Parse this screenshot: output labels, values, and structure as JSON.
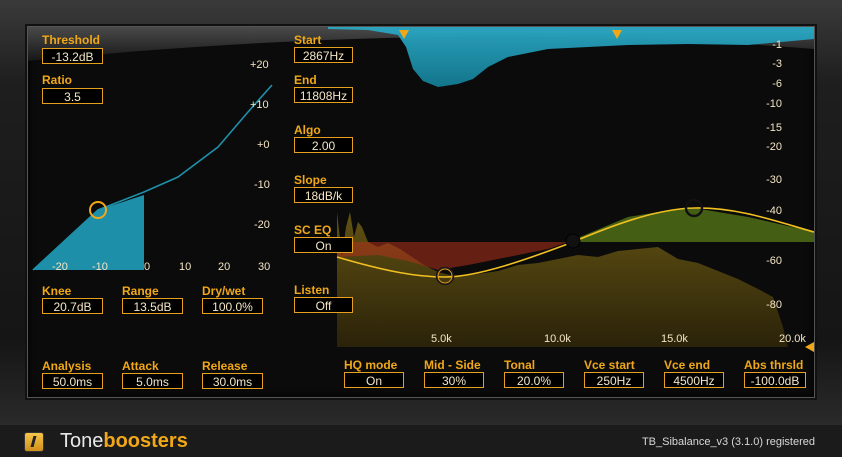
{
  "left_controls": {
    "threshold": {
      "label": "Threshold",
      "value": "-13.2dB"
    },
    "ratio": {
      "label": "Ratio",
      "value": "3.5"
    },
    "knee": {
      "label": "Knee",
      "value": "20.7dB"
    },
    "range": {
      "label": "Range",
      "value": "13.5dB"
    },
    "drywet": {
      "label": "Dry/wet",
      "value": "100.0%"
    },
    "analysis": {
      "label": "Analysis",
      "value": "50.0ms"
    },
    "attack": {
      "label": "Attack",
      "value": "5.0ms"
    },
    "release": {
      "label": "Release",
      "value": "30.0ms"
    }
  },
  "transfer_graph": {
    "y_ticks": [
      "+20",
      "+10",
      "+0",
      "-10",
      "-20"
    ],
    "x_ticks": [
      "-20",
      "-10",
      "0",
      "10",
      "20",
      "30"
    ]
  },
  "mid_controls": {
    "start": {
      "label": "Start",
      "value": "2867Hz"
    },
    "end": {
      "label": "End",
      "value": "11808Hz"
    },
    "algo": {
      "label": "Algo",
      "value": "2.00"
    },
    "slope": {
      "label": "Slope",
      "value": "18dB/k"
    },
    "sceq": {
      "label": "SC EQ",
      "value": "On"
    },
    "listen": {
      "label": "Listen",
      "value": "Off"
    }
  },
  "spectrum": {
    "db_labels": [
      "-1",
      "-3",
      "-6",
      "-10",
      "-15",
      "-20",
      "-30",
      "-40",
      "-60",
      "-80"
    ],
    "freq_labels": [
      "5.0k",
      "10.0k",
      "15.0k",
      "20.0k"
    ]
  },
  "bottom_controls": {
    "hqmode": {
      "label": "HQ mode",
      "value": "On"
    },
    "midside": {
      "label": "Mid - Side",
      "value": "30%"
    },
    "tonal": {
      "label": "Tonal",
      "value": "20.0%"
    },
    "vcestart": {
      "label": "Vce start",
      "value": "250Hz"
    },
    "vceend": {
      "label": "Vce end",
      "value": "4500Hz"
    },
    "absthrsld": {
      "label": "Abs thrsld",
      "value": "-100.0dB"
    }
  },
  "footer": {
    "brand_light": "Tone",
    "brand_bold": "boosters",
    "status": "TB_Sibalance_v3 (3.1.0) registered"
  },
  "colors": {
    "accent": "#f0a818",
    "teal": "#1e8fa8"
  }
}
